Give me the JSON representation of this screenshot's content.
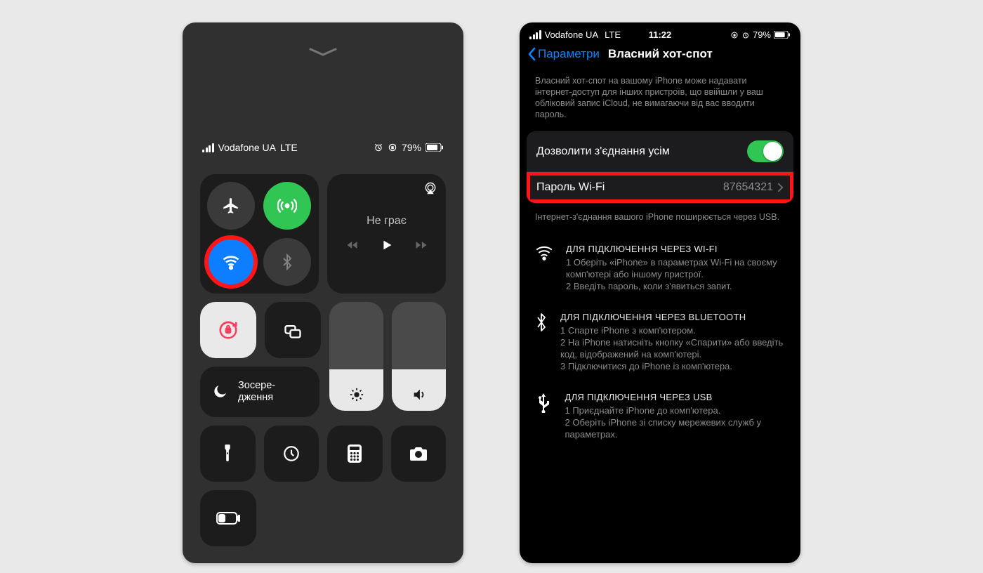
{
  "cc": {
    "carrier": "Vodafone UA",
    "net": "LTE",
    "battery": "79%",
    "media_title": "Не грає",
    "focus_line1": "Зосере-",
    "focus_line2": "дження"
  },
  "settings": {
    "status": {
      "carrier": "Vodafone UA",
      "net": "LTE",
      "time": "11:22",
      "battery": "79%"
    },
    "back": "Параметри",
    "title": "Власний хот-спот",
    "descr": "Власний хот-спот на вашому iPhone може надавати інтернет-доступ для інших пристроїв, що ввійшли у ваш обліковий запис iCloud, не вимагаючи від вас вводити пароль.",
    "allow_label": "Дозволити з'єднання усім",
    "pwd_label": "Пароль Wi-Fi",
    "pwd_value": "87654321",
    "usb_note": "Інтернет-з'єднання вашого iPhone поширюється через USB.",
    "wifi": {
      "hd": "ДЛЯ ПІДКЛЮЧЕННЯ ЧЕРЕЗ WI-FI",
      "l1": "1 Оберіть «iPhone» в параметрах Wi-Fi на своєму комп'ютері або іншому пристрої.",
      "l2": "2 Введіть пароль, коли з'явиться запит."
    },
    "bt": {
      "hd": "ДЛЯ ПІДКЛЮЧЕННЯ ЧЕРЕЗ BLUETOOTH",
      "l1": "1 Спарте iPhone з комп'ютером.",
      "l2": "2 На iPhone натисніть кнопку «Спарити» або введіть код, відображений на комп'ютері.",
      "l3": "3 Підключитися до iPhone із комп'ютера."
    },
    "usb": {
      "hd": "ДЛЯ ПІДКЛЮЧЕННЯ ЧЕРЕЗ USB",
      "l1": "1 Приєднайте iPhone до комп'ютера.",
      "l2": "2 Оберіть iPhone зі списку мережевих служб у параметрах."
    }
  }
}
